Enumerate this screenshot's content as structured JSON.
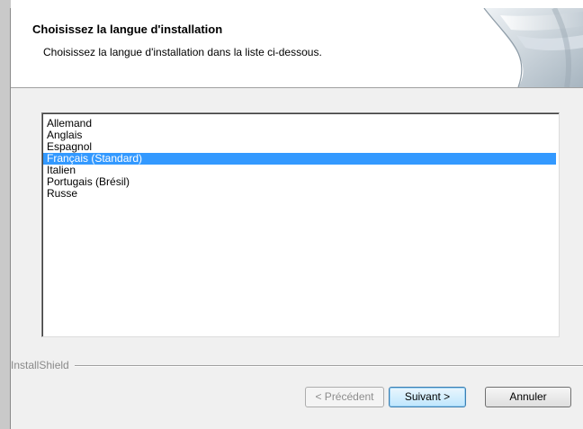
{
  "header": {
    "title": "Choisissez la langue d'installation",
    "subtitle": "Choisissez la langue d'installation dans la liste ci-dessous."
  },
  "languages": {
    "items": [
      "Allemand",
      "Anglais",
      "Espagnol",
      "Français (Standard)",
      "Italien",
      "Portugais (Brésil)",
      "Russe"
    ],
    "selected": "Français (Standard)"
  },
  "brand": {
    "label": "InstallShield"
  },
  "buttons": {
    "back": "< Précédent",
    "next": "Suivant >",
    "cancel": "Annuler"
  },
  "colors": {
    "selection": "#3399ff",
    "dialog_background": "#f0f0f0",
    "header_background": "#ffffff"
  },
  "icons": {
    "header_graphic": "installer-banner-graphic"
  }
}
